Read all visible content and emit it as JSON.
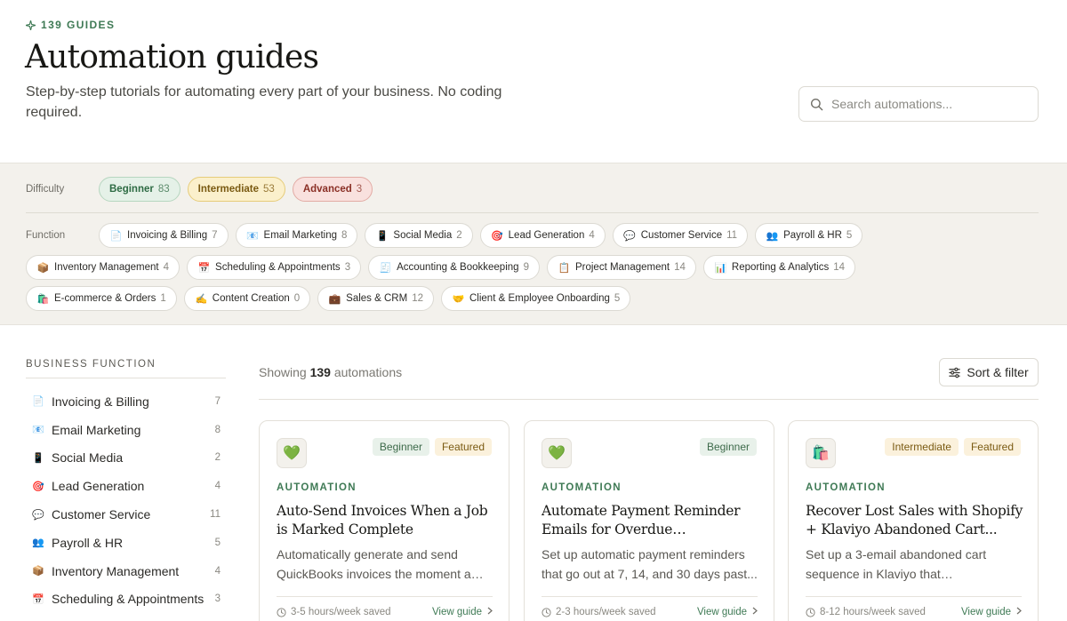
{
  "header": {
    "eyebrow": "139 GUIDES",
    "title": "Automation guides",
    "subtitle": "Step-by-step tutorials for automating every part of your business. No coding required.",
    "search_placeholder": "Search automations..."
  },
  "filters": {
    "difficulty_label": "Difficulty",
    "difficulty": [
      {
        "label": "Beginner",
        "count": "83",
        "style": "beg"
      },
      {
        "label": "Intermediate",
        "count": "53",
        "style": "int"
      },
      {
        "label": "Advanced",
        "count": "3",
        "style": "adv"
      }
    ],
    "function_label": "Function",
    "functions": [
      {
        "icon": "📄",
        "icon_name": "document-icon",
        "label": "Invoicing & Billing",
        "count": "7"
      },
      {
        "icon": "📧",
        "icon_name": "email-icon",
        "label": "Email Marketing",
        "count": "8"
      },
      {
        "icon": "📱",
        "icon_name": "phone-icon",
        "label": "Social Media",
        "count": "2"
      },
      {
        "icon": "🎯",
        "icon_name": "target-icon",
        "label": "Lead Generation",
        "count": "4"
      },
      {
        "icon": "💬",
        "icon_name": "chat-icon",
        "label": "Customer Service",
        "count": "11"
      },
      {
        "icon": "👥",
        "icon_name": "people-icon",
        "label": "Payroll & HR",
        "count": "5"
      },
      {
        "icon": "📦",
        "icon_name": "package-icon",
        "label": "Inventory Management",
        "count": "4"
      },
      {
        "icon": "📅",
        "icon_name": "calendar-icon",
        "label": "Scheduling & Appointments",
        "count": "3"
      },
      {
        "icon": "🧾",
        "icon_name": "receipt-icon",
        "label": "Accounting & Bookkeeping",
        "count": "9"
      },
      {
        "icon": "📋",
        "icon_name": "clipboard-icon",
        "label": "Project Management",
        "count": "14"
      },
      {
        "icon": "📊",
        "icon_name": "bar-chart-icon",
        "label": "Reporting & Analytics",
        "count": "14"
      },
      {
        "icon": "🛍️",
        "icon_name": "shopping-bags-icon",
        "label": "E-commerce & Orders",
        "count": "1"
      },
      {
        "icon": "✍️",
        "icon_name": "writing-hand-icon",
        "label": "Content Creation",
        "count": "0"
      },
      {
        "icon": "💼",
        "icon_name": "briefcase-icon",
        "label": "Sales & CRM",
        "count": "12"
      },
      {
        "icon": "🤝",
        "icon_name": "handshake-icon",
        "label": "Client & Employee Onboarding",
        "count": "5"
      }
    ]
  },
  "sidebar": {
    "title": "BUSINESS FUNCTION",
    "items": [
      {
        "icon": "📄",
        "icon_name": "document-icon",
        "label": "Invoicing & Billing",
        "count": "7"
      },
      {
        "icon": "📧",
        "icon_name": "email-icon",
        "label": "Email Marketing",
        "count": "8"
      },
      {
        "icon": "📱",
        "icon_name": "phone-icon",
        "label": "Social Media",
        "count": "2"
      },
      {
        "icon": "🎯",
        "icon_name": "target-icon",
        "label": "Lead Generation",
        "count": "4"
      },
      {
        "icon": "💬",
        "icon_name": "chat-icon",
        "label": "Customer Service",
        "count": "11"
      },
      {
        "icon": "👥",
        "icon_name": "people-icon",
        "label": "Payroll & HR",
        "count": "5"
      },
      {
        "icon": "📦",
        "icon_name": "package-icon",
        "label": "Inventory Management",
        "count": "4"
      },
      {
        "icon": "📅",
        "icon_name": "calendar-icon",
        "label": "Scheduling & Appointments",
        "count": "3"
      }
    ]
  },
  "main": {
    "showing_prefix": "Showing",
    "showing_count": "139",
    "showing_suffix": "automations",
    "sort_label": "Sort & filter",
    "cards": [
      {
        "thumb": "💚",
        "thumb_name": "green-heart-icon",
        "tags": [
          {
            "label": "Beginner",
            "style": "beg"
          },
          {
            "label": "Featured",
            "style": "feat"
          }
        ],
        "kicker": "AUTOMATION",
        "title": "Auto-Send Invoices When a Job is Marked Complete",
        "desc": "Automatically generate and send QuickBooks invoices the moment a jo...",
        "saved": "3-5 hours/week saved",
        "cta": "View guide"
      },
      {
        "thumb": "💚",
        "thumb_name": "green-heart-icon",
        "tags": [
          {
            "label": "Beginner",
            "style": "beg"
          }
        ],
        "kicker": "AUTOMATION",
        "title": "Automate Payment Reminder Emails for Overdue QuickBooks...",
        "desc": "Set up automatic payment reminders that go out at 7, 14, and 30 days past...",
        "saved": "2-3 hours/week saved",
        "cta": "View guide"
      },
      {
        "thumb": "🛍️",
        "thumb_name": "shopping-bags-icon",
        "tags": [
          {
            "label": "Intermediate",
            "style": "int"
          },
          {
            "label": "Featured",
            "style": "feat"
          }
        ],
        "kicker": "AUTOMATION",
        "title": "Recover Lost Sales with Shopify + Klaviyo Abandoned Cart...",
        "desc": "Set up a 3-email abandoned cart sequence in Klaviyo that automatically...",
        "saved": "8-12 hours/week saved",
        "cta": "View guide"
      }
    ]
  }
}
